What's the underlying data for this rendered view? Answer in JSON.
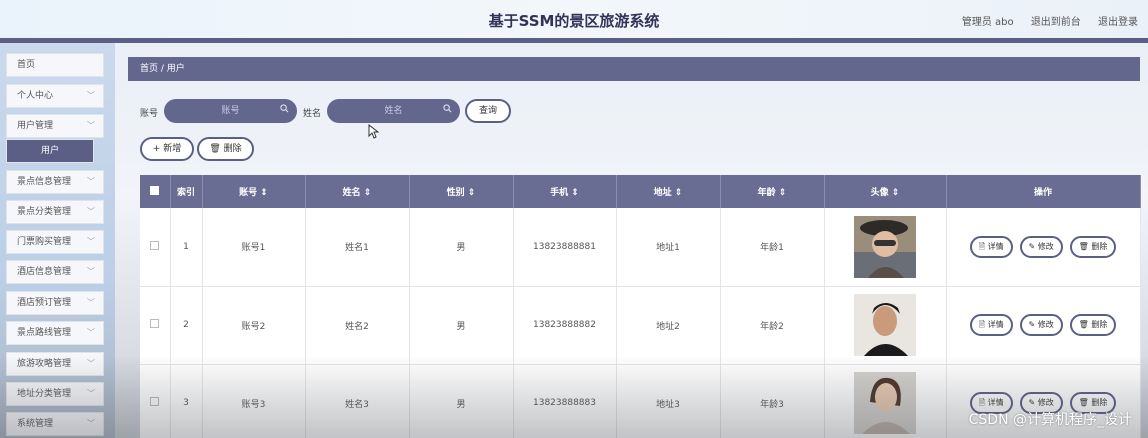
{
  "header": {
    "title": "基于SSM的景区旅游系统",
    "links": [
      "管理员 abo",
      "退出到前台",
      "退出登录"
    ]
  },
  "sidebar": {
    "items": [
      {
        "label": "首页",
        "chevron": false
      },
      {
        "label": "个人中心",
        "chevron": true
      },
      {
        "label": "用户管理",
        "chevron": true
      },
      {
        "label": "用户",
        "chevron": false,
        "active": true
      },
      {
        "label": "景点信息管理",
        "chevron": true
      },
      {
        "label": "景点分类管理",
        "chevron": true
      },
      {
        "label": "门票购买管理",
        "chevron": true
      },
      {
        "label": "酒店信息管理",
        "chevron": true
      },
      {
        "label": "酒店预订管理",
        "chevron": true
      },
      {
        "label": "景点路线管理",
        "chevron": true
      },
      {
        "label": "旅游攻略管理",
        "chevron": true
      },
      {
        "label": "地址分类管理",
        "chevron": true
      },
      {
        "label": "系统管理",
        "chevron": true
      }
    ],
    "chevron_glyph": "﹀"
  },
  "breadcrumb": "首页 / 用户",
  "search": {
    "account_label": "账号",
    "account_placeholder": "账号",
    "name_label": "姓名",
    "name_placeholder": "姓名",
    "query_button": "查询"
  },
  "actions": {
    "add": "+ 新增",
    "delete": "删除"
  },
  "table": {
    "columns": [
      "索引",
      "账号 ⇕",
      "姓名 ⇕",
      "性别 ⇕",
      "手机 ⇕",
      "地址 ⇕",
      "年龄 ⇕",
      "头像 ⇕",
      "操作"
    ],
    "rows": [
      {
        "index": "1",
        "account": "账号1",
        "name": "姓名1",
        "gender": "男",
        "phone": "13823888881",
        "address": "地址1",
        "age": "年龄1"
      },
      {
        "index": "2",
        "account": "账号2",
        "name": "姓名2",
        "gender": "男",
        "phone": "13823888882",
        "address": "地址2",
        "age": "年龄2"
      },
      {
        "index": "3",
        "account": "账号3",
        "name": "姓名3",
        "gender": "男",
        "phone": "13823888883",
        "address": "地址3",
        "age": "年龄3"
      }
    ],
    "ops": {
      "detail": "详情",
      "edit": "修改",
      "delete": "删除"
    }
  },
  "watermark": "CSDN @计算机程序_设计",
  "colors": {
    "primary": "#5b5f86",
    "header_row": "#6a6d93"
  }
}
